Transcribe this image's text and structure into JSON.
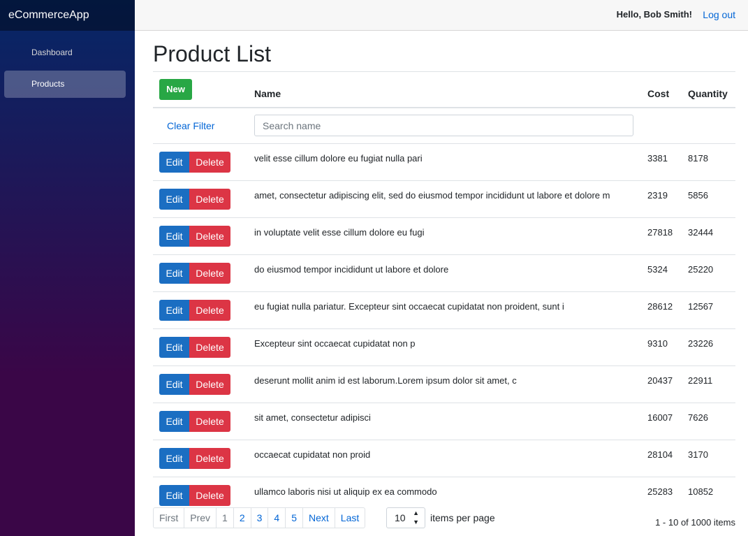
{
  "app": {
    "brand": "eCommerceApp"
  },
  "sidebar": {
    "items": [
      {
        "label": "Dashboard",
        "active": false
      },
      {
        "label": "Products",
        "active": true
      }
    ]
  },
  "topbar": {
    "greeting": "Hello, Bob Smith!",
    "logout": "Log out"
  },
  "page": {
    "title": "Product List"
  },
  "table": {
    "new_label": "New",
    "columns": {
      "name": "Name",
      "cost": "Cost",
      "quantity": "Quantity"
    },
    "clear_filter": "Clear Filter",
    "search_placeholder": "Search name",
    "edit_label": "Edit",
    "delete_label": "Delete",
    "rows": [
      {
        "name": "velit esse cillum dolore eu fugiat nulla pari",
        "cost": "3381",
        "quantity": "8178"
      },
      {
        "name": "amet, consectetur adipiscing elit, sed do eiusmod tempor incididunt ut labore et dolore m",
        "cost": "2319",
        "quantity": "5856"
      },
      {
        "name": "in voluptate velit esse cillum dolore eu fugi",
        "cost": "27818",
        "quantity": "32444"
      },
      {
        "name": "do eiusmod tempor incididunt ut labore et dolore",
        "cost": "5324",
        "quantity": "25220"
      },
      {
        "name": "eu fugiat nulla pariatur. Excepteur sint occaecat cupidatat non proident, sunt i",
        "cost": "28612",
        "quantity": "12567"
      },
      {
        "name": "Excepteur sint occaecat cupidatat non p",
        "cost": "9310",
        "quantity": "23226"
      },
      {
        "name": "deserunt mollit anim id est laborum.Lorem ipsum dolor sit amet, c",
        "cost": "20437",
        "quantity": "22911"
      },
      {
        "name": "sit amet, consectetur adipisci",
        "cost": "16007",
        "quantity": "7626"
      },
      {
        "name": "occaecat cupidatat non proid",
        "cost": "28104",
        "quantity": "3170"
      },
      {
        "name": "ullamco laboris nisi ut aliquip ex ea commodo",
        "cost": "25283",
        "quantity": "10852"
      }
    ]
  },
  "pagination": {
    "first": "First",
    "prev": "Prev",
    "pages": [
      "1",
      "2",
      "3",
      "4",
      "5"
    ],
    "next": "Next",
    "last": "Last",
    "page_size": "10",
    "items_per_page": "items per page",
    "summary": "1 - 10 of 1000 items"
  },
  "colors": {
    "sidebar_top": "#052767",
    "sidebar_bottom": "#3a0647",
    "new": "#28a745",
    "edit": "#1b6ec2",
    "delete": "#dc3545",
    "link": "#0366d6"
  }
}
